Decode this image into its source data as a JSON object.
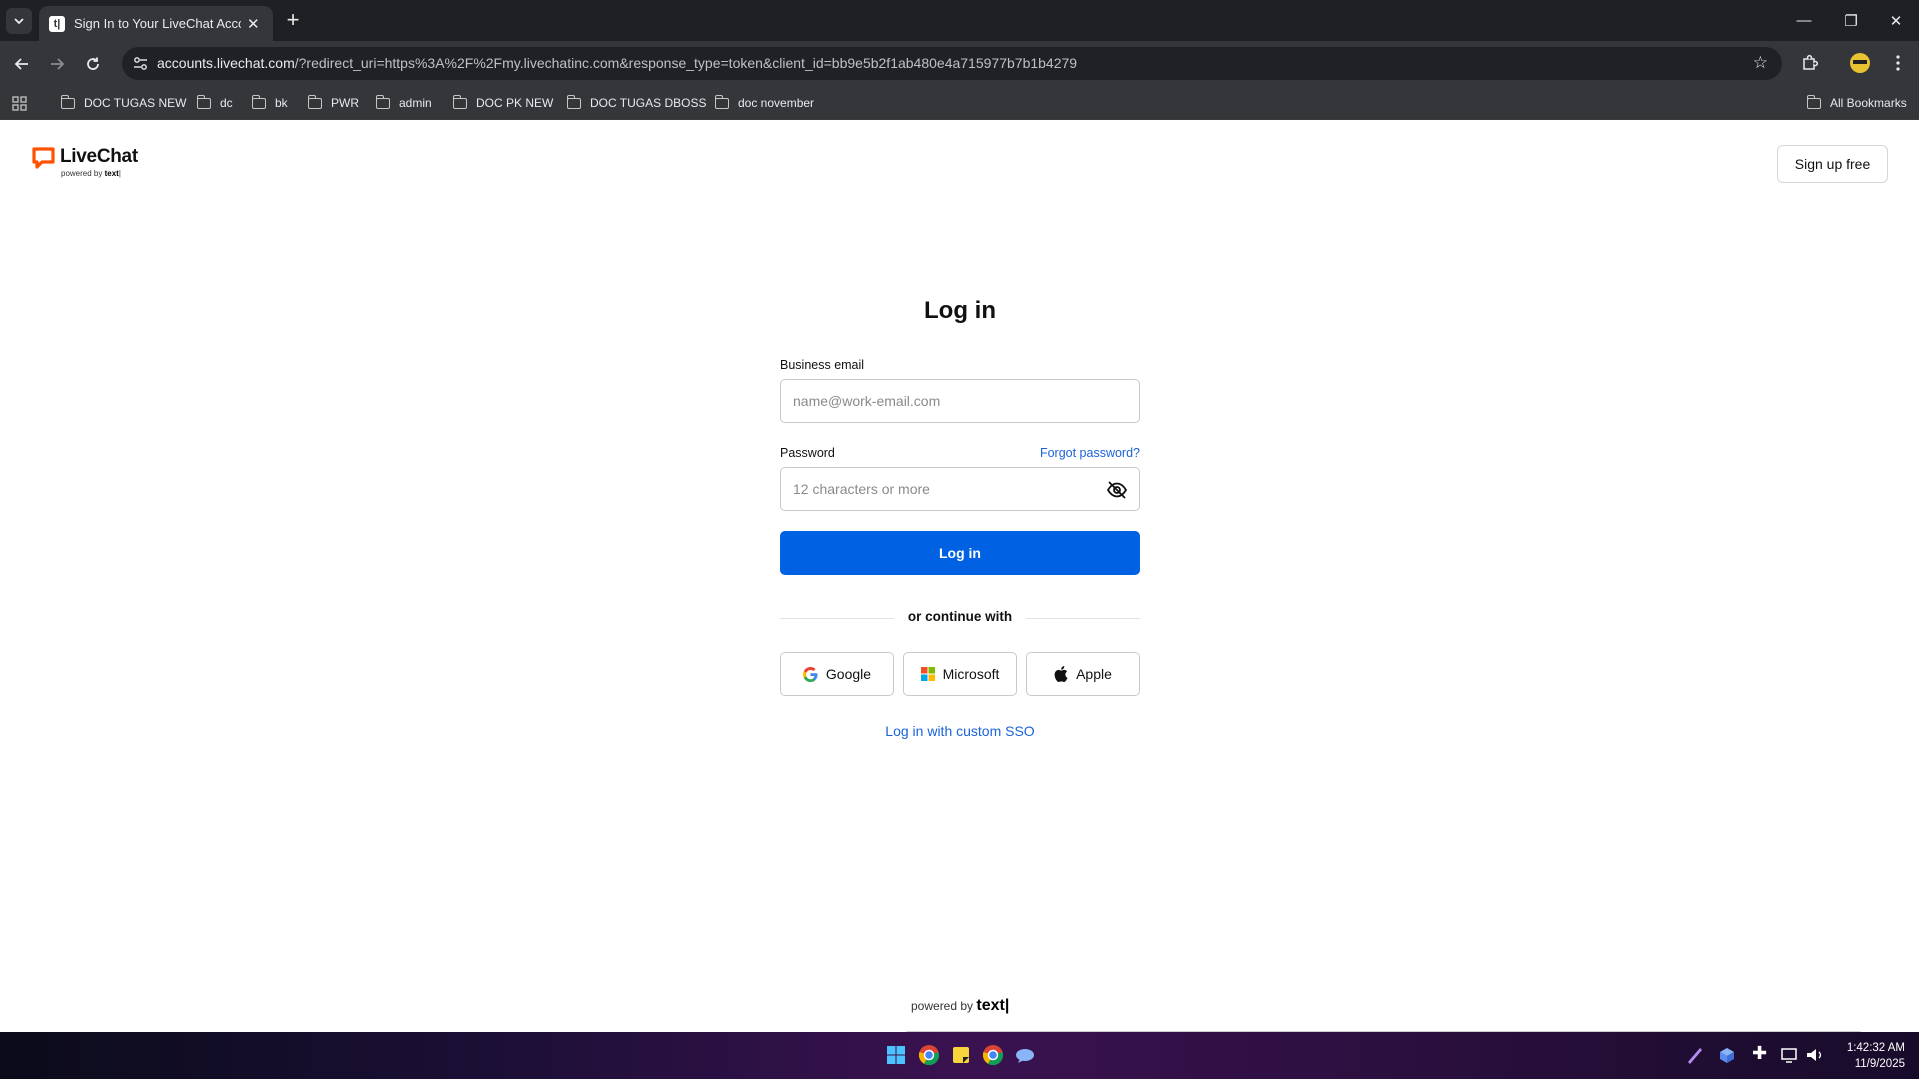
{
  "browser": {
    "tab_title": "Sign In to Your LiveChat Accou",
    "url_host": "accounts.livechat.com",
    "url_rest": "/?redirect_uri=https%3A%2F%2Fmy.livechatinc.com&response_type=token&client_id=bb9e5b2f1ab480e4a715977b7b1b4279",
    "bookmarks": [
      "DOC TUGAS NEW",
      "dc",
      "bk",
      "PWR",
      "admin",
      "DOC PK NEW",
      "DOC TUGAS DBOSS",
      "doc november"
    ],
    "all_bookmarks": "All Bookmarks"
  },
  "header": {
    "logo_name": "LiveChat",
    "logo_powered_prefix": "powered by",
    "logo_powered_brand": "text",
    "signup_label": "Sign up free"
  },
  "form": {
    "title": "Log in",
    "email_label": "Business email",
    "email_placeholder": "name@work-email.com",
    "password_label": "Password",
    "forgot_label": "Forgot password?",
    "password_placeholder": "12 characters or more",
    "login_button": "Log in",
    "divider_text": "or continue with",
    "google_label": "Google",
    "microsoft_label": "Microsoft",
    "apple_label": "Apple",
    "custom_sso_label": "Log in with custom SSO"
  },
  "footer": {
    "powered_prefix": "powered by",
    "powered_brand": "text"
  },
  "taskbar": {
    "time": "1:42:32 AM",
    "date": "11/9/2025"
  },
  "colors": {
    "primary_button": "#0062e3",
    "link": "#1a63d8",
    "brand_orange": "#ff5100"
  }
}
